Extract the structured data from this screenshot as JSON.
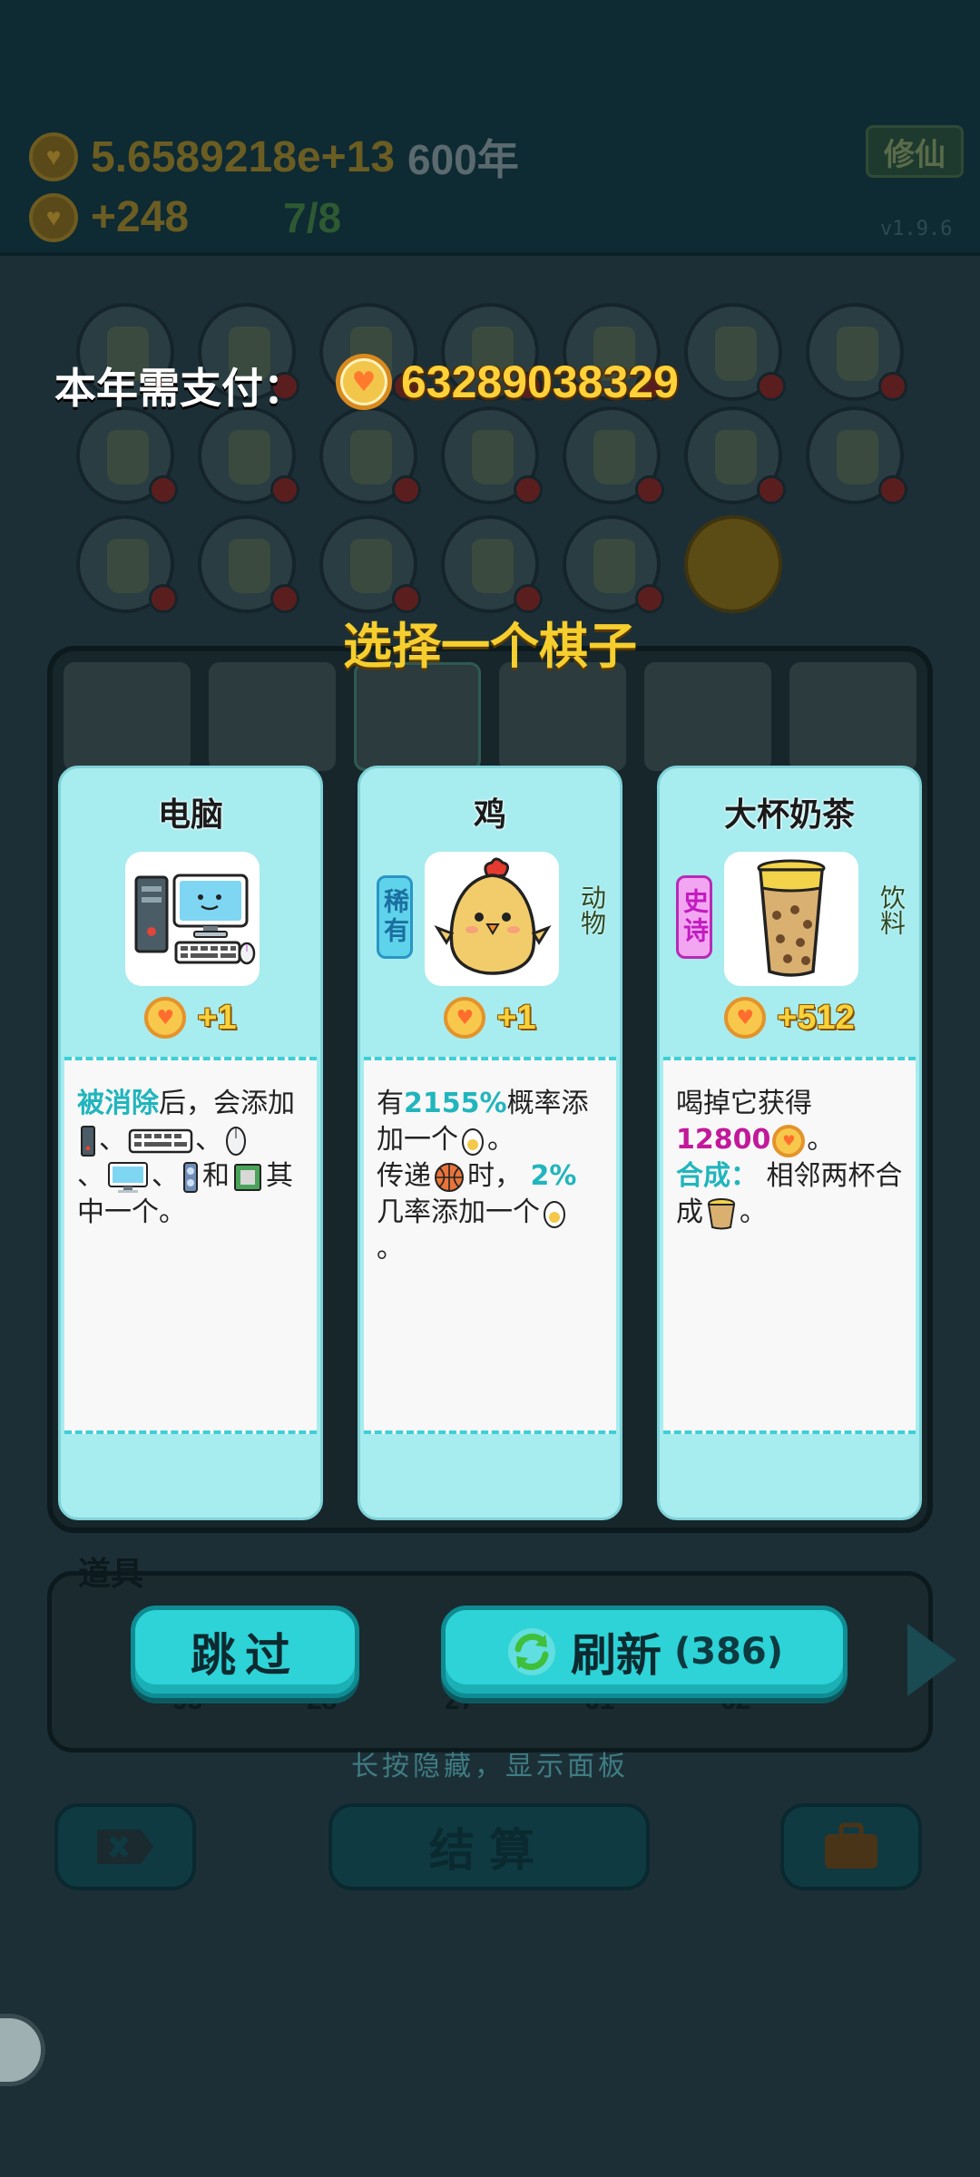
{
  "hud": {
    "coins": "5.6589218e+13",
    "year": "600年",
    "income": "+248",
    "round": "7/8",
    "xiuxian_label": "修仙",
    "version": "v1.9.6"
  },
  "payment": {
    "label": "本年需支付：",
    "amount": "63289038329"
  },
  "choose_title": "选择一个棋子",
  "cards": [
    {
      "name": "电脑",
      "value": "+1",
      "icon": "computer-icon"
    },
    {
      "name": "鸡",
      "rarity": "稀有",
      "category": "动物",
      "value": "+1",
      "icon": "chicken-icon"
    },
    {
      "name": "大杯奶茶",
      "rarity": "史诗",
      "category": "饮料",
      "value": "+512",
      "icon": "milk-tea-icon"
    }
  ],
  "desc": {
    "computer": {
      "a": "被消除",
      "b": "后，会添加",
      "c": "、",
      "d": "、",
      "e": "、",
      "f": "、",
      "g": "和",
      "h": "其中一个。"
    },
    "chicken": {
      "a": "有",
      "b": "2155%",
      "c": "概率添加一个",
      "d": "。",
      "e": "传递",
      "f": "时，",
      "g": "2%",
      "h": "几率添加一个",
      "i": "。"
    },
    "milktea": {
      "a": "喝掉它获得",
      "b": "12800",
      "c": "。",
      "d": "合成：",
      "e": "相邻两杯合成",
      "f": "。"
    }
  },
  "colors": {
    "card_bg": "#a7ecef",
    "accent_teal": "#21b5bd",
    "coin_gold": "#f7c84c",
    "title_yellow": "#f6cf2f"
  },
  "items_label": "道具",
  "item_counts": [
    "95",
    "28",
    "27",
    "61",
    "62"
  ],
  "buttons": {
    "skip": "跳过",
    "refresh": "刷新",
    "refresh_count": "(386)",
    "settle": "结算"
  },
  "hint": "长按隐藏，显示面板"
}
